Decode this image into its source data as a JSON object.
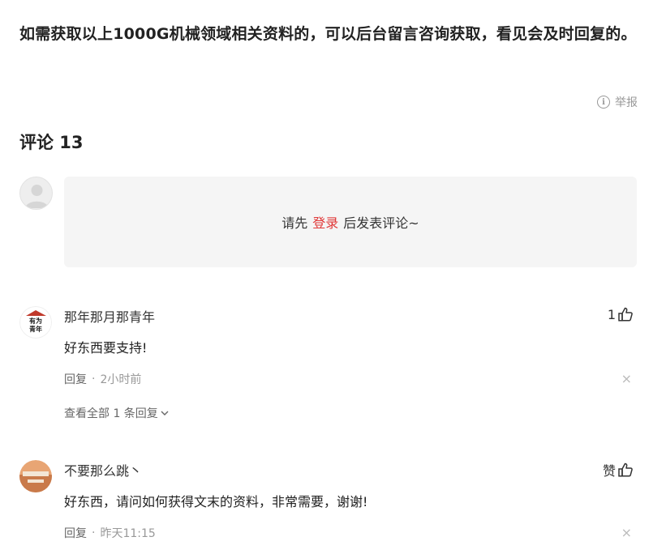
{
  "article": {
    "text": "如需获取以上1000G机械领域相关资料的，可以后台留言咨询获取，看见会及时回复的。"
  },
  "report_label": "举报",
  "comments_header": {
    "title": "评论 13"
  },
  "comment_box": {
    "prefix": "请先",
    "login_label": "登录",
    "suffix": "后发表评论~"
  },
  "comments": [
    {
      "author": "那年那月那青年",
      "likes": "1",
      "text": "好东西要支持!",
      "reply_label": "回复",
      "separator": "·",
      "time": "2小时前",
      "close_symbol": "×",
      "view_all": "查看全部 1 条回复",
      "avatar_text": "有为青年"
    },
    {
      "author": "不要那么跳丶",
      "likes": "赞",
      "text": "好东西，请问如何获得文末的资料，非常需要，谢谢!",
      "reply_label": "回复",
      "separator": "·",
      "time": "昨天11:15",
      "close_symbol": "×"
    }
  ],
  "colors": {
    "login_link": "#e03737",
    "meta_gray": "#999999",
    "box_bg": "#f5f5f5"
  }
}
